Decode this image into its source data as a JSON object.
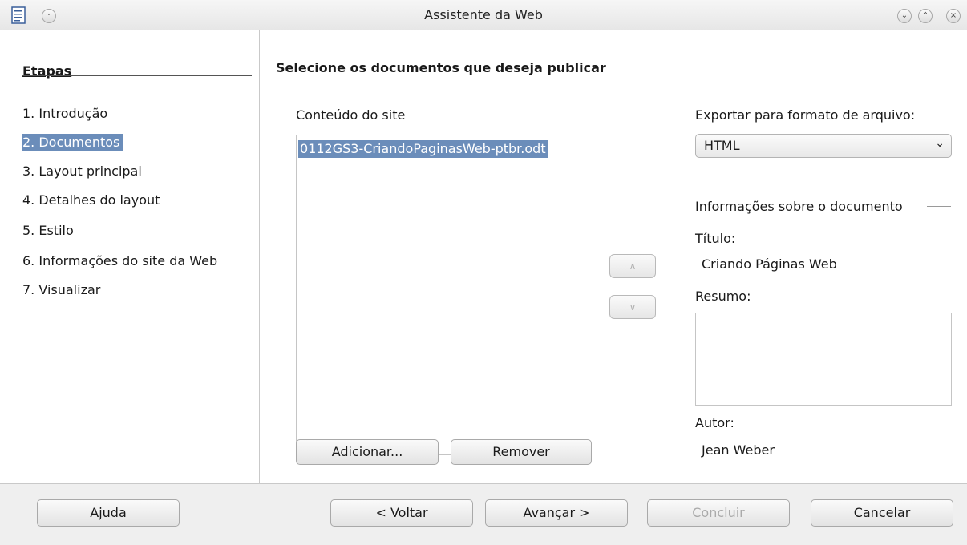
{
  "window": {
    "title": "Assistente da Web"
  },
  "steps": {
    "title": "Etapas",
    "items": [
      {
        "label": "1. Introdução"
      },
      {
        "label": "2. Documentos"
      },
      {
        "label": "3. Layout principal"
      },
      {
        "label": "4. Detalhes do layout"
      },
      {
        "label": "5. Estilo"
      },
      {
        "label": "6. Informações do site da Web"
      },
      {
        "label": "7. Visualizar"
      }
    ],
    "selected": "2. Documentos"
  },
  "main": {
    "heading": "Selecione os documentos que deseja publicar",
    "content_label": "Conteúdo do site",
    "content_items": [
      "0112GS3-CriandoPaginasWeb-ptbr.odt"
    ],
    "add_button": "Adicionar...",
    "remove_button": "Remover",
    "export_label": "Exportar para formato de arquivo:",
    "export_value": "HTML",
    "doc_info_label": "Informações sobre o documento",
    "title_label": "Título:",
    "title_value": "Criando Páginas Web",
    "summary_label": "Resumo:",
    "summary_value": "",
    "author_label": "Autor:",
    "author_value": "Jean Weber"
  },
  "footer": {
    "help": "Ajuda",
    "back": "< Voltar",
    "next": "Avançar >",
    "finish": "Concluir",
    "cancel": "Cancelar"
  },
  "icons": {
    "up": "up-arrow-icon",
    "down": "down-arrow-icon",
    "select": "chevron-down-icon"
  },
  "colors": {
    "selection": "#6b8dba",
    "background": "#efefef",
    "panel": "#ffffff"
  }
}
